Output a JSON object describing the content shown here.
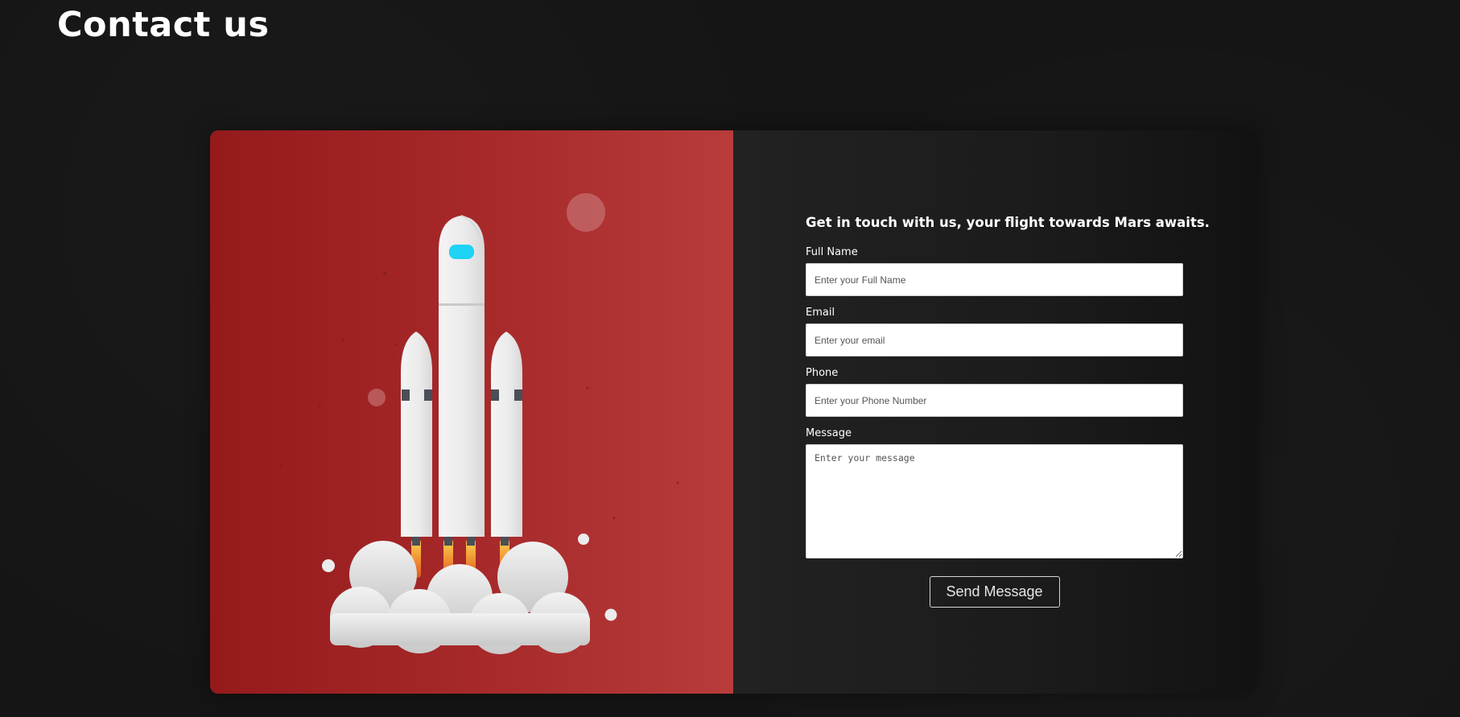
{
  "page": {
    "title": "Contact us"
  },
  "illustration": {
    "icon": "rocket-launch-illustration",
    "colors": {
      "panel_start": "#951a1b",
      "panel_end": "#b83c3b",
      "rocket_body": "#ececec",
      "window": "#1fd3f5",
      "flame": "#f6a623"
    }
  },
  "contact_form": {
    "heading": "Get in touch with us, your flight towards Mars awaits.",
    "fields": {
      "full_name": {
        "label": "Full Name",
        "placeholder": "Enter your Full Name",
        "value": ""
      },
      "email": {
        "label": "Email",
        "placeholder": "Enter your email",
        "value": ""
      },
      "phone": {
        "label": "Phone",
        "placeholder": "Enter your Phone Number",
        "value": ""
      },
      "message": {
        "label": "Message",
        "placeholder": "Enter your message",
        "value": ""
      }
    },
    "submit_label": "Send Message"
  }
}
